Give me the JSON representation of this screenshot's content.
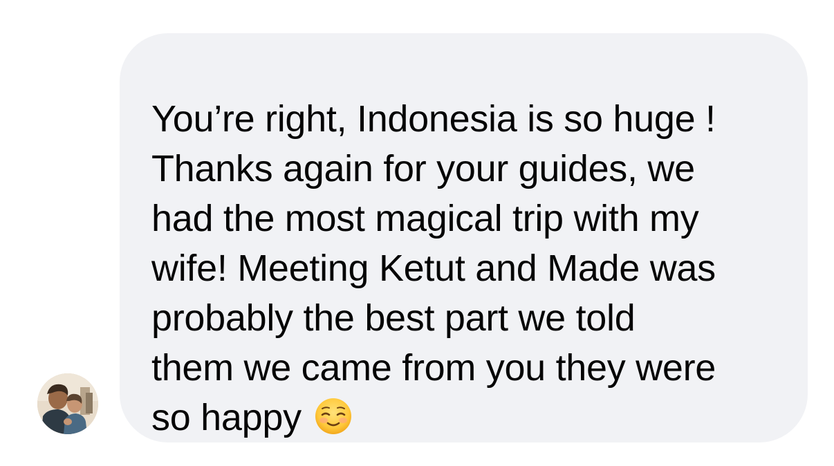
{
  "conversation": {
    "message": {
      "text": "You’re right, Indonesia is so huge !\nThanks again for your guides, we\nhad the most magical trip with my\nwife! Meeting Ketut and Made was\nprobably the best part we told\nthem we came from you they were\nso happy",
      "emoji": "smiling-face-icon"
    },
    "colors": {
      "bubble_background": "#f1f2f5",
      "text": "#050505"
    }
  }
}
